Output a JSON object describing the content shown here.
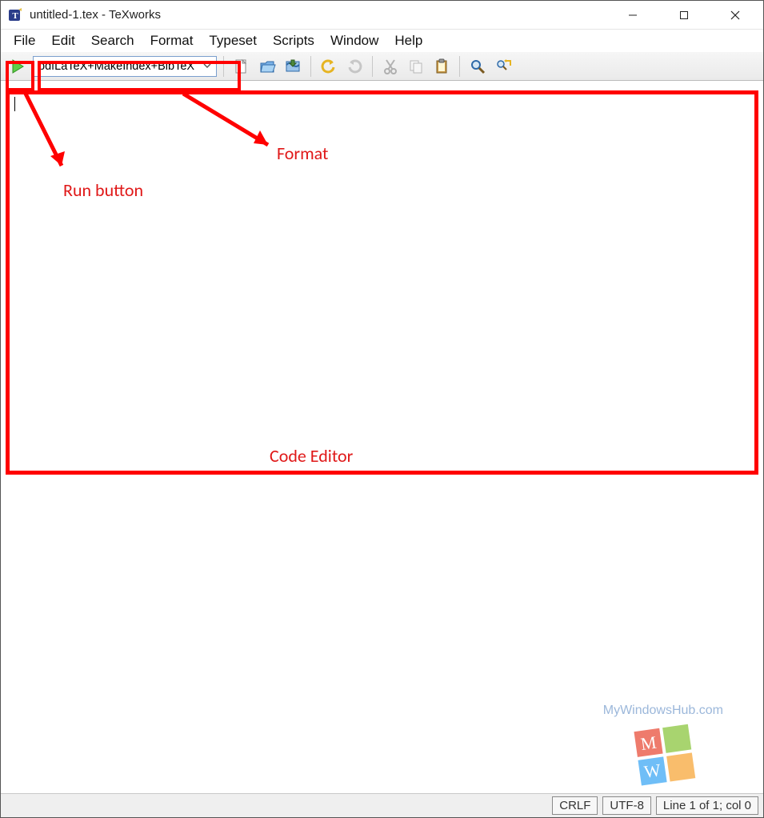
{
  "window": {
    "title": "untitled-1.tex - TeXworks"
  },
  "menus": {
    "file": "File",
    "edit": "Edit",
    "search": "Search",
    "format": "Format",
    "typeset": "Typeset",
    "scripts": "Scripts",
    "window": "Window",
    "help": "Help"
  },
  "toolbar": {
    "format_selected": "pdfLaTeX+MakeIndex+BibTeX"
  },
  "annotations": {
    "run_button": "Run button",
    "format": "Format",
    "code_editor": "Code Editor"
  },
  "status": {
    "line_ending": "CRLF",
    "encoding": "UTF-8",
    "position": "Line 1 of 1; col 0"
  },
  "watermark": {
    "text": "MyWindowsHub.com"
  }
}
